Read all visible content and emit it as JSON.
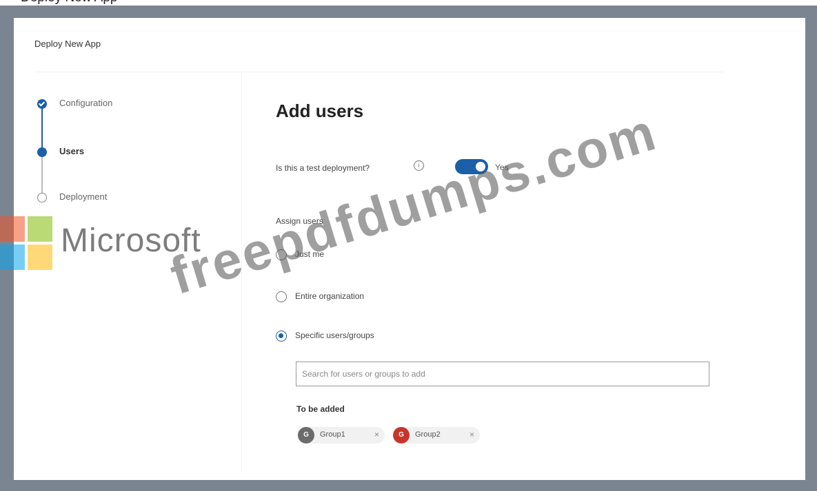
{
  "window": {
    "title": "Deploy New App"
  },
  "steps": [
    {
      "label": "Configuration",
      "state": "done"
    },
    {
      "label": "Users",
      "state": "current"
    },
    {
      "label": "Deployment",
      "state": "pending"
    }
  ],
  "main": {
    "heading": "Add users",
    "test_deployment": {
      "label": "Is this a test deployment?",
      "toggle_label": "Yes",
      "checked": true
    },
    "assign": {
      "label": "Assign users",
      "options": [
        {
          "label": "Just me",
          "checked": false
        },
        {
          "label": "Entire organization",
          "checked": false
        },
        {
          "label": "Specific users/groups",
          "checked": true
        }
      ]
    },
    "search": {
      "placeholder": "Search for users or groups to add",
      "value": ""
    },
    "to_be_added": {
      "label": "To be added",
      "chips": [
        {
          "initial": "G",
          "name": "Group1",
          "color": "#6b6b6b"
        },
        {
          "initial": "G",
          "name": "Group2",
          "color": "#c8352b"
        }
      ]
    }
  },
  "watermark": {
    "logo_text": "Microsoft",
    "url": "freepdfdumps.com",
    "logo_colors": [
      "#f35325",
      "#81bc06",
      "#05a6f0",
      "#ffba08"
    ]
  },
  "colors": {
    "accent": "#1b5fa8",
    "frame": "#7b8592"
  }
}
